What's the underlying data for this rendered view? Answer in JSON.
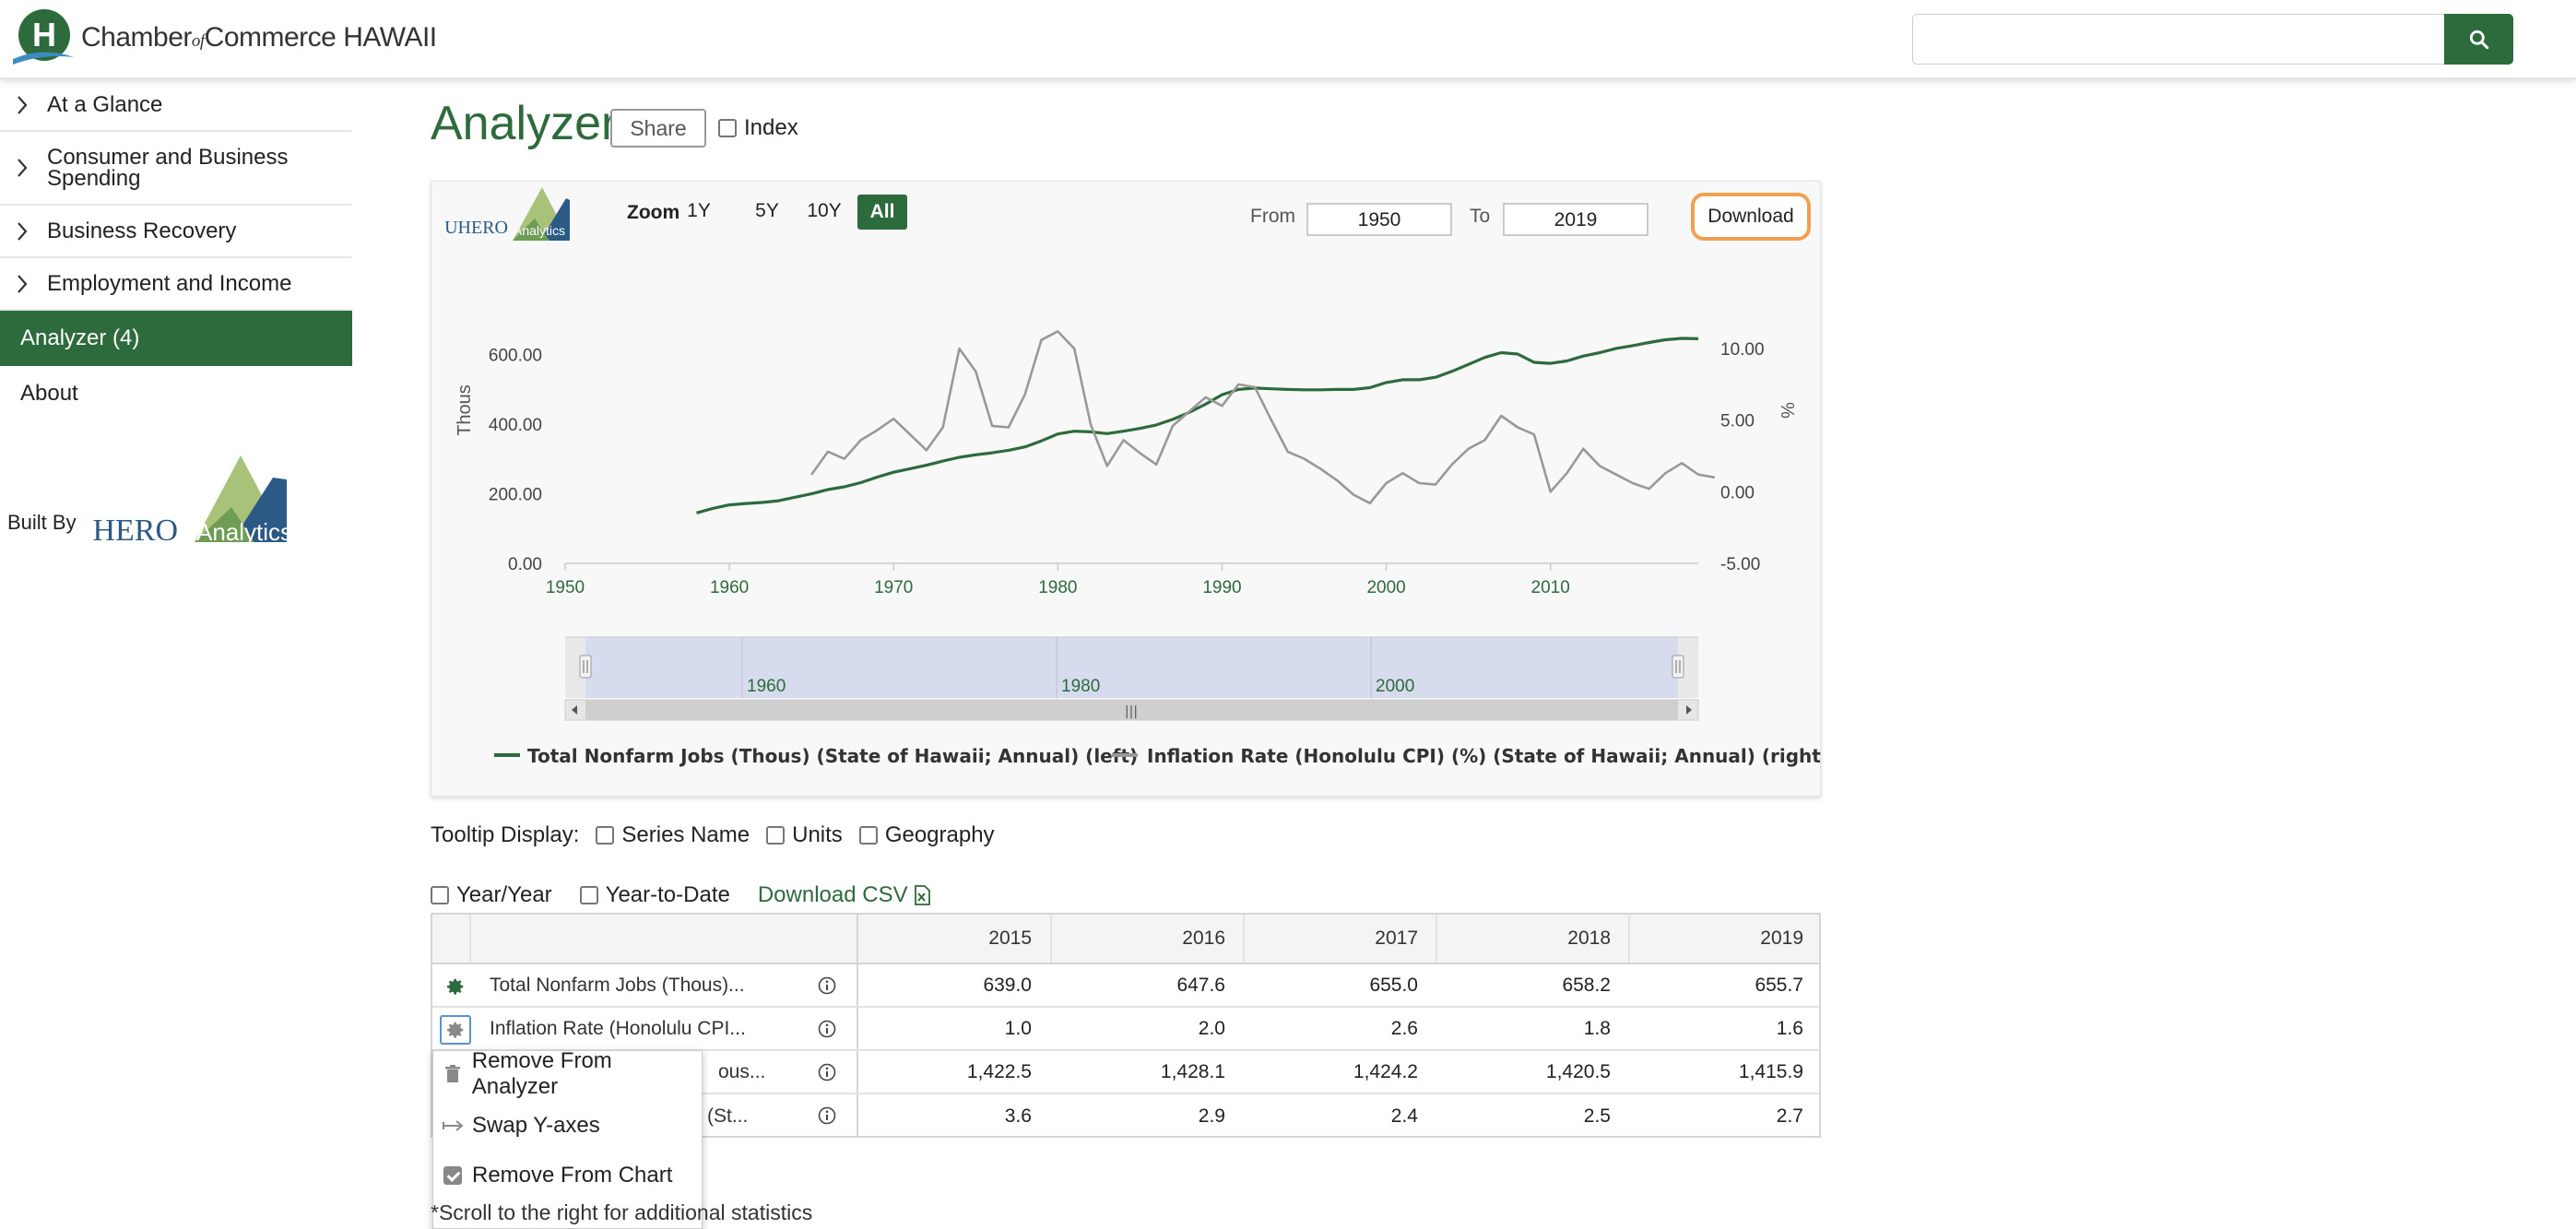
{
  "header": {
    "brand": {
      "chamber": "Chamber",
      "of": "of",
      "commerce": "Commerce HAWAII",
      "logo_letter": "H"
    },
    "search": {
      "placeholder": "",
      "value": "",
      "icon": "search-icon"
    }
  },
  "sidebar": {
    "items": [
      {
        "label": "At a Glance",
        "icon": "chevron-right-icon"
      },
      {
        "label": "Consumer and Business Spending",
        "icon": "chevron-right-icon"
      },
      {
        "label": "Business Recovery",
        "icon": "chevron-right-icon"
      },
      {
        "label": "Employment and Income",
        "icon": "chevron-right-icon"
      }
    ],
    "active_item": "Analyzer (4)",
    "about": "About",
    "built_by": "Built By",
    "uhero_logo": {
      "text1": "UHERO",
      "text2": "Analytics"
    }
  },
  "main": {
    "title": "Analyzer",
    "share_label": "Share",
    "index_label": "Index",
    "index_checked": false
  },
  "chart_toolbar": {
    "logo": {
      "text1": "UHERO",
      "text2": "Analytics"
    },
    "zoom_label": "Zoom",
    "zoom_buttons": [
      "1Y",
      "5Y",
      "10Y",
      "All"
    ],
    "zoom_active": "All",
    "from_label": "From",
    "from_value": "1950",
    "to_label": "To",
    "to_value": "2019",
    "download_label": "Download"
  },
  "chart_data": {
    "type": "line",
    "left_axis": {
      "label": "Thous",
      "range": [
        0,
        700
      ],
      "ticks": [
        "0.00",
        "200.00",
        "400.00",
        "600.00"
      ]
    },
    "right_axis": {
      "label": "%",
      "range": [
        -5,
        12
      ],
      "ticks": [
        "-5.00",
        "0.00",
        "5.00",
        "10.00"
      ]
    },
    "x_axis": {
      "range": [
        1950,
        2019
      ],
      "ticks": [
        "1950",
        "1960",
        "1970",
        "1980",
        "1990",
        "2000",
        "2010"
      ]
    },
    "navigator_ticks": [
      "1960",
      "1980",
      "2000"
    ],
    "grid": false,
    "legend_position": "bottom",
    "series": [
      {
        "name": "Total Nonfarm Jobs (Thous) (State of Hawaii; Annual) (left)",
        "axis": "left",
        "color": "#2d6a3c",
        "points": [
          [
            1958,
            145
          ],
          [
            1959,
            158
          ],
          [
            1960,
            168
          ],
          [
            1961,
            172
          ],
          [
            1962,
            175
          ],
          [
            1963,
            180
          ],
          [
            1964,
            190
          ],
          [
            1965,
            200
          ],
          [
            1966,
            212
          ],
          [
            1967,
            220
          ],
          [
            1968,
            232
          ],
          [
            1969,
            248
          ],
          [
            1970,
            262
          ],
          [
            1971,
            272
          ],
          [
            1972,
            282
          ],
          [
            1973,
            294
          ],
          [
            1974,
            305
          ],
          [
            1975,
            312
          ],
          [
            1976,
            318
          ],
          [
            1977,
            325
          ],
          [
            1978,
            335
          ],
          [
            1979,
            352
          ],
          [
            1980,
            372
          ],
          [
            1981,
            380
          ],
          [
            1982,
            378
          ],
          [
            1983,
            373
          ],
          [
            1984,
            380
          ],
          [
            1985,
            388
          ],
          [
            1986,
            398
          ],
          [
            1987,
            414
          ],
          [
            1988,
            434
          ],
          [
            1989,
            458
          ],
          [
            1990,
            485
          ],
          [
            1991,
            500
          ],
          [
            1992,
            504
          ],
          [
            1993,
            502
          ],
          [
            1994,
            500
          ],
          [
            1995,
            499
          ],
          [
            1996,
            499
          ],
          [
            1997,
            500
          ],
          [
            1998,
            500
          ],
          [
            1999,
            505
          ],
          [
            2000,
            520
          ],
          [
            2001,
            528
          ],
          [
            2002,
            528
          ],
          [
            2003,
            535
          ],
          [
            2004,
            552
          ],
          [
            2005,
            572
          ],
          [
            2006,
            592
          ],
          [
            2007,
            606
          ],
          [
            2008,
            602
          ],
          [
            2009,
            578
          ],
          [
            2010,
            575
          ],
          [
            2011,
            582
          ],
          [
            2012,
            596
          ],
          [
            2013,
            606
          ],
          [
            2014,
            618
          ],
          [
            2015,
            626
          ],
          [
            2016,
            635
          ],
          [
            2017,
            643
          ],
          [
            2018,
            647
          ],
          [
            2019,
            646
          ]
        ]
      },
      {
        "name": "Inflation Rate (Honolulu CPI) (%) (State of Hawaii; Annual) (right)",
        "axis": "right",
        "color": "#999999",
        "points": [
          [
            1965,
            1.2
          ],
          [
            1966,
            2.8
          ],
          [
            1967,
            2.3
          ],
          [
            1968,
            3.6
          ],
          [
            1969,
            4.3
          ],
          [
            1970,
            5.1
          ],
          [
            1971,
            4.0
          ],
          [
            1972,
            2.9
          ],
          [
            1973,
            4.5
          ],
          [
            1974,
            10.0
          ],
          [
            1975,
            8.4
          ],
          [
            1976,
            4.6
          ],
          [
            1977,
            4.5
          ],
          [
            1978,
            6.8
          ],
          [
            1979,
            10.6
          ],
          [
            1980,
            11.2
          ],
          [
            1981,
            10.0
          ],
          [
            1982,
            4.7
          ],
          [
            1983,
            1.8
          ],
          [
            1984,
            3.6
          ],
          [
            1985,
            2.7
          ],
          [
            1986,
            1.9
          ],
          [
            1987,
            4.6
          ],
          [
            1988,
            5.6
          ],
          [
            1989,
            6.6
          ],
          [
            1990,
            6.0
          ],
          [
            1991,
            7.5
          ],
          [
            1992,
            7.3
          ],
          [
            1993,
            5.0
          ],
          [
            1994,
            2.8
          ],
          [
            1995,
            2.3
          ],
          [
            1996,
            1.6
          ],
          [
            1997,
            0.8
          ],
          [
            1998,
            -0.2
          ],
          [
            1999,
            -0.8
          ],
          [
            2000,
            0.6
          ],
          [
            2001,
            1.3
          ],
          [
            2002,
            0.6
          ],
          [
            2003,
            0.5
          ],
          [
            2004,
            1.9
          ],
          [
            2005,
            3.0
          ],
          [
            2006,
            3.6
          ],
          [
            2007,
            5.3
          ],
          [
            2008,
            4.5
          ],
          [
            2009,
            4.0
          ],
          [
            2010,
            0.0
          ],
          [
            2011,
            1.3
          ],
          [
            2012,
            3.0
          ],
          [
            2013,
            1.8
          ],
          [
            2014,
            1.2
          ],
          [
            2015,
            0.6
          ],
          [
            2016,
            0.2
          ],
          [
            2017,
            1.3
          ],
          [
            2018,
            2.0
          ],
          [
            2019,
            1.2
          ],
          [
            2020,
            1.0
          ]
        ]
      }
    ]
  },
  "legend": [
    {
      "label": "Total Nonfarm Jobs (Thous) (State of Hawaii; Annual) (left)",
      "color": "#2d6a3c"
    },
    {
      "label": "Inflation Rate (Honolulu CPI) (%) (State of Hawaii; Annual) (right)",
      "color": "#999999"
    }
  ],
  "tooltip_display": {
    "label": "Tooltip Display:",
    "options": [
      {
        "label": "Series Name",
        "checked": false
      },
      {
        "label": "Units",
        "checked": false
      },
      {
        "label": "Geography",
        "checked": false
      }
    ]
  },
  "calc_options": {
    "year_year": "Year/Year",
    "ytd": "Year-to-Date",
    "download_csv": "Download CSV"
  },
  "table": {
    "years": [
      "2015",
      "2016",
      "2017",
      "2018",
      "2019"
    ],
    "rows": [
      {
        "name": "Total Nonfarm Jobs (Thous)...",
        "values": [
          "639.0",
          "647.6",
          "655.0",
          "658.2",
          "655.7"
        ]
      },
      {
        "name": "Inflation Rate (Honolulu CPI...",
        "values": [
          "1.0",
          "2.0",
          "2.6",
          "1.8",
          "1.6"
        ]
      },
      {
        "name": "ous...",
        "values": [
          "1,422.5",
          "1,428.1",
          "1,424.2",
          "1,420.5",
          "1,415.9"
        ]
      },
      {
        "name": "(St...",
        "values": [
          "3.6",
          "2.9",
          "2.4",
          "2.5",
          "2.7"
        ]
      }
    ]
  },
  "context_menu": {
    "items": [
      {
        "label": "Remove From Analyzer",
        "icon": "trash-icon"
      },
      {
        "label": "Swap Y-axes",
        "icon": "swap-icon"
      },
      {
        "label": "Remove From Chart",
        "icon": "checkbox-checked-icon"
      }
    ]
  },
  "footnote": "*Scroll to the right for additional statistics",
  "colors": {
    "brand_green": "#2d6a3c",
    "download_outline": "#f0a050",
    "navigator_fill": "#d6dcee"
  }
}
